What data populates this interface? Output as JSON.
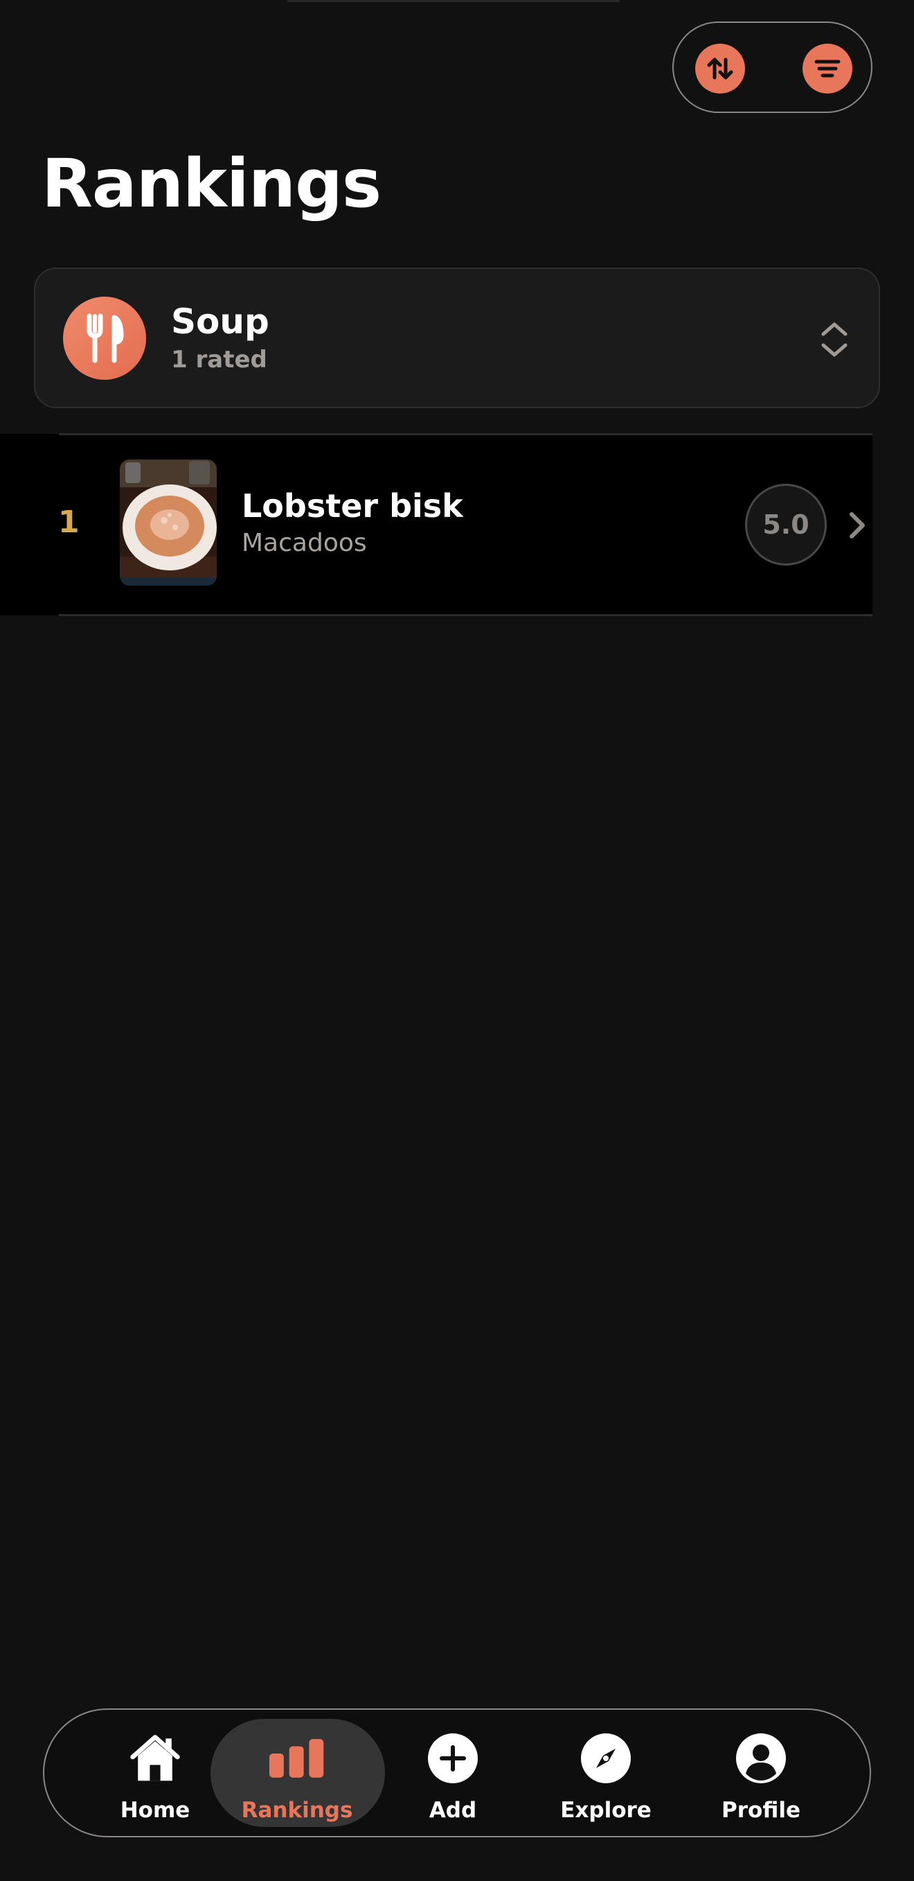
{
  "header": {
    "title": "Rankings",
    "actions": [
      {
        "name": "sort",
        "icon": "sort-arrows-icon"
      },
      {
        "name": "filter",
        "icon": "filter-lines-icon"
      }
    ]
  },
  "category": {
    "name": "Soup",
    "count_label": "1 rated",
    "icon": "fork-knife-icon",
    "selector_icon": "chevron-up-down-icon"
  },
  "rankings": [
    {
      "rank": "1",
      "name": "Lobster bisk",
      "place": "Macadoos",
      "score": "5.0"
    }
  ],
  "tabs": [
    {
      "label": "Home",
      "icon": "house-icon",
      "active": false
    },
    {
      "label": "Rankings",
      "icon": "bar-chart-icon",
      "active": true
    },
    {
      "label": "Add",
      "icon": "plus-circle-icon",
      "active": false
    },
    {
      "label": "Explore",
      "icon": "compass-icon",
      "active": false
    },
    {
      "label": "Profile",
      "icon": "person-circle-icon",
      "active": false
    }
  ],
  "colors": {
    "background": "#121111",
    "accent": "#e8765a",
    "rank_gold": "#d9a94e",
    "card": "#1c1b1b",
    "row": "#000000"
  }
}
